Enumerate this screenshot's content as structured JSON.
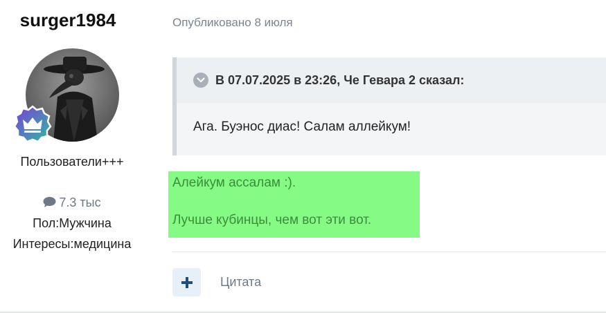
{
  "author": {
    "username": "surger1984",
    "group": "Пользователи+++",
    "post_count": "7.3 тыс",
    "gender": "Пол:Мужчина",
    "interests": "Интересы:медицина",
    "badge_icon": "crown-icon"
  },
  "post": {
    "published": "Опубликовано 8 июля",
    "quote": {
      "cite": "В 07.07.2025 в 23:26, Че Гевара 2 сказал:",
      "text": "Ага. Буэнос диас! Салам аллейкум!"
    },
    "reply_lines": [
      "Алейкум ассалам :).",
      "Лучше кубинцы, чем вот эти вот."
    ]
  },
  "actions": {
    "add_label": "+",
    "quote_label": "Цитата"
  },
  "colors": {
    "highlight": "#85fb85",
    "reply_text": "#3a8e3a",
    "muted": "#6d7988",
    "add_icon": "#1e4f7a"
  }
}
